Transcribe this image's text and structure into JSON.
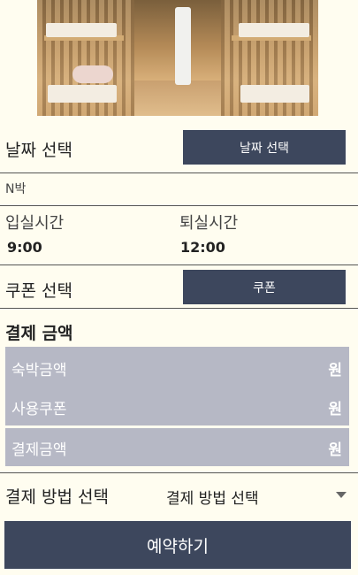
{
  "date": {
    "label": "날짜 선택",
    "button": "날짜 선택",
    "nights": "N박"
  },
  "times": {
    "checkin_label": "입실시간",
    "checkin_value": "9:00",
    "checkout_label": "퇴실시간",
    "checkout_value": "12:00"
  },
  "coupon": {
    "label": "쿠폰 선택",
    "button": "쿠폰"
  },
  "payment": {
    "title": "결제 금액",
    "rows": [
      {
        "label": "숙박금액",
        "unit": "원"
      },
      {
        "label": "사용쿠폰",
        "unit": "원"
      },
      {
        "label": "결제금액",
        "unit": "원"
      }
    ]
  },
  "method": {
    "label": "결제 방법 선택",
    "selected": "결제 방법 선택"
  },
  "reserve_button": "예약하기",
  "colors": {
    "accent": "#3d475d",
    "box": "#b6b8c5",
    "background": "#fffdf0"
  }
}
